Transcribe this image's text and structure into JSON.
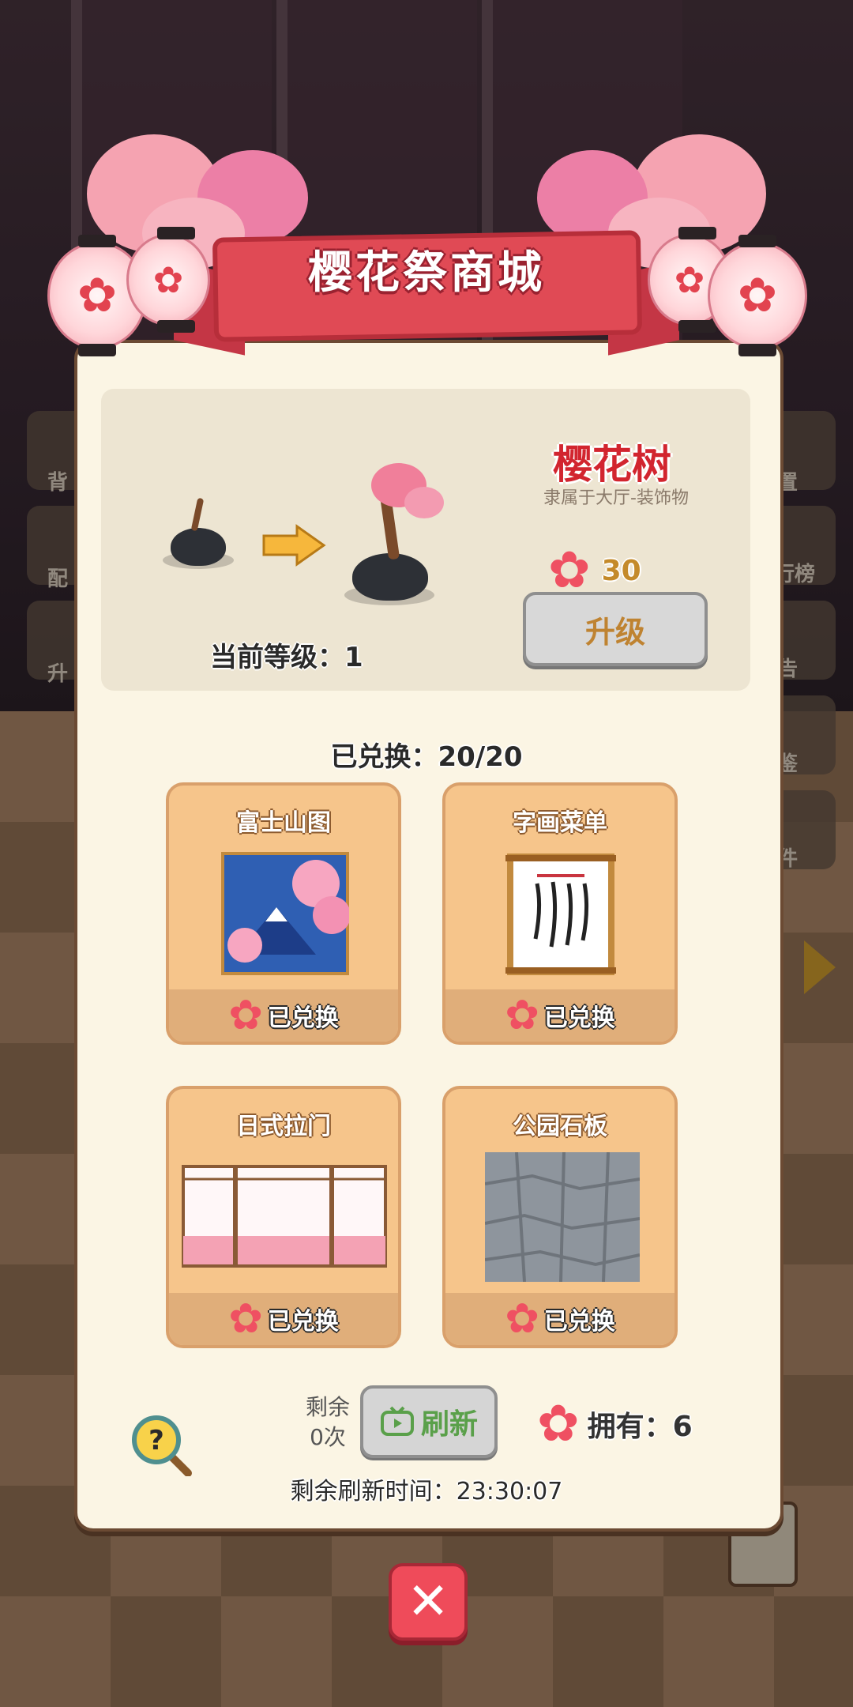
{
  "shop": {
    "title": "樱花祭商城",
    "close_icon": "close-icon",
    "help_icon": "magnifier-question-icon"
  },
  "upgrade_item": {
    "name": "樱花树",
    "category": "隶属于大厅-装饰物",
    "cost": "30",
    "upgrade_label": "升级",
    "current_level_label": "当前等级：1"
  },
  "exchange": {
    "count_label": "已兑换：20/20",
    "cards": [
      {
        "title": "富士山图",
        "status": "已兑换"
      },
      {
        "title": "字画菜单",
        "status": "已兑换"
      },
      {
        "title": "日式拉门",
        "status": "已兑换"
      },
      {
        "title": "公园石板",
        "status": "已兑换"
      }
    ]
  },
  "footer": {
    "remaining_label": "剩余",
    "remaining_count": "0次",
    "refresh_label": "刷新",
    "owned_label": "拥有：6",
    "refresh_timer": "剩余刷新时间：23:30:07"
  },
  "background": {
    "left_menu": [
      "背",
      "配",
      "升"
    ],
    "right_menu": [
      "置",
      "行榜",
      "告",
      "鉴",
      "件"
    ]
  },
  "colors": {
    "accent_red": "#e04a55",
    "card_bg": "#f6c58b",
    "panel_bg": "#fbf5e4",
    "sakura_pink": "#ef5062"
  }
}
